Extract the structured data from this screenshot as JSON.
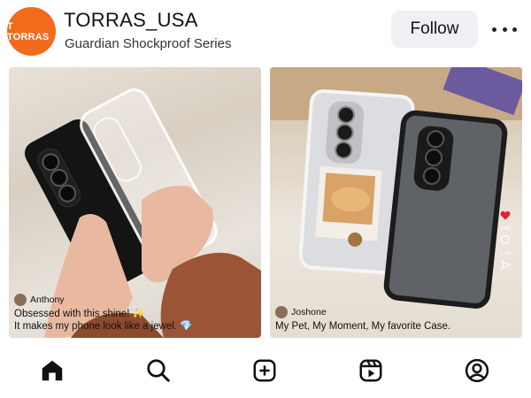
{
  "header": {
    "avatar_text": "T TORRAS",
    "account_name": "TORRAS_USA",
    "subtitle": "Guardian Shockproof Series",
    "follow_label": "Follow",
    "more_icon": "more-horizontal-icon"
  },
  "posts": [
    {
      "commenter": "Anthony",
      "caption_lines": [
        "Obsessed with this shine! ✨",
        "It makes my phone look like a jewel. 💎"
      ]
    },
    {
      "commenter": "Joshone",
      "caption_lines": [
        "My Pet, My Moment, My favorite Case."
      ],
      "side_counts": [
        "376K",
        "1,138"
      ]
    }
  ],
  "nav": {
    "items": [
      {
        "name": "home",
        "icon": "home-icon"
      },
      {
        "name": "search",
        "icon": "search-icon"
      },
      {
        "name": "create",
        "icon": "plus-square-icon"
      },
      {
        "name": "reels",
        "icon": "reels-icon"
      },
      {
        "name": "profile",
        "icon": "profile-icon"
      }
    ]
  },
  "colors": {
    "brand": "#f26a1b",
    "follow_bg": "#eef0f3"
  }
}
